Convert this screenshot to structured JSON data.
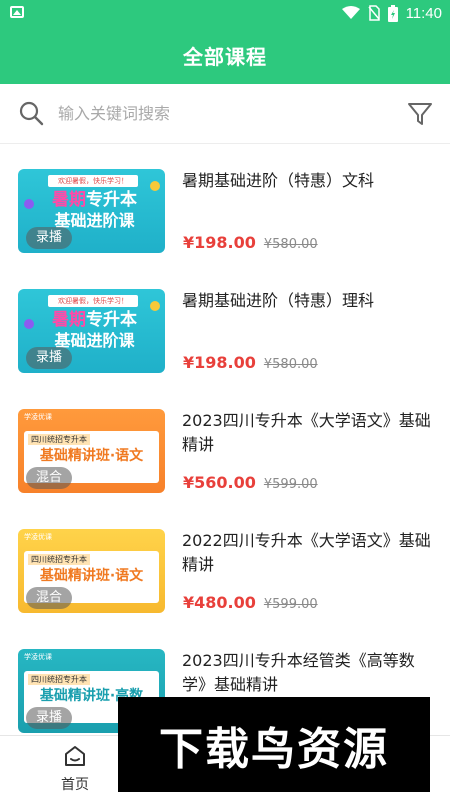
{
  "status_bar": {
    "time": "11:40"
  },
  "header": {
    "title": "全部课程"
  },
  "search": {
    "placeholder": "输入关键词搜索"
  },
  "courses": [
    {
      "title": "暑期基础进阶（特惠）文科",
      "price": "¥198.00",
      "old_price": "¥580.00",
      "badge": "录播",
      "thumb": {
        "ribbon": "欢迎暑假，快乐学习！",
        "line1_accent": "暑期",
        "line1": "专升本",
        "line2": "基础进阶课"
      }
    },
    {
      "title": "暑期基础进阶（特惠）理科",
      "price": "¥198.00",
      "old_price": "¥580.00",
      "badge": "录播",
      "thumb": {
        "ribbon": "欢迎暑假，快乐学习！",
        "line1_accent": "暑期",
        "line1": "专升本",
        "line2": "基础进阶课"
      }
    },
    {
      "title": "2023四川专升本《大学语文》基础精讲",
      "price": "¥560.00",
      "old_price": "¥599.00",
      "badge": "混合",
      "thumb": {
        "brand": "学凌优课",
        "sub": "四川统招专升本",
        "main": "基础精讲班·语文"
      }
    },
    {
      "title": "2022四川专升本《大学语文》基础精讲",
      "price": "¥480.00",
      "old_price": "¥599.00",
      "badge": "混合",
      "thumb": {
        "brand": "学凌优课",
        "sub": "四川统招专升本",
        "main": "基础精讲班·语文"
      }
    },
    {
      "title": "2023四川专升本经管类《高等数学》基础精讲",
      "price": "",
      "old_price": "",
      "badge": "录播",
      "thumb": {
        "brand": "学凌优课",
        "sub": "四川统招专升本",
        "main": "基础精讲班·高数"
      }
    }
  ],
  "bottom_nav": {
    "home_label": "首页"
  },
  "watermark": {
    "text": "下载鸟资源"
  },
  "colors": {
    "brand_green": "#2dc97e",
    "price_red": "#e8403b"
  }
}
